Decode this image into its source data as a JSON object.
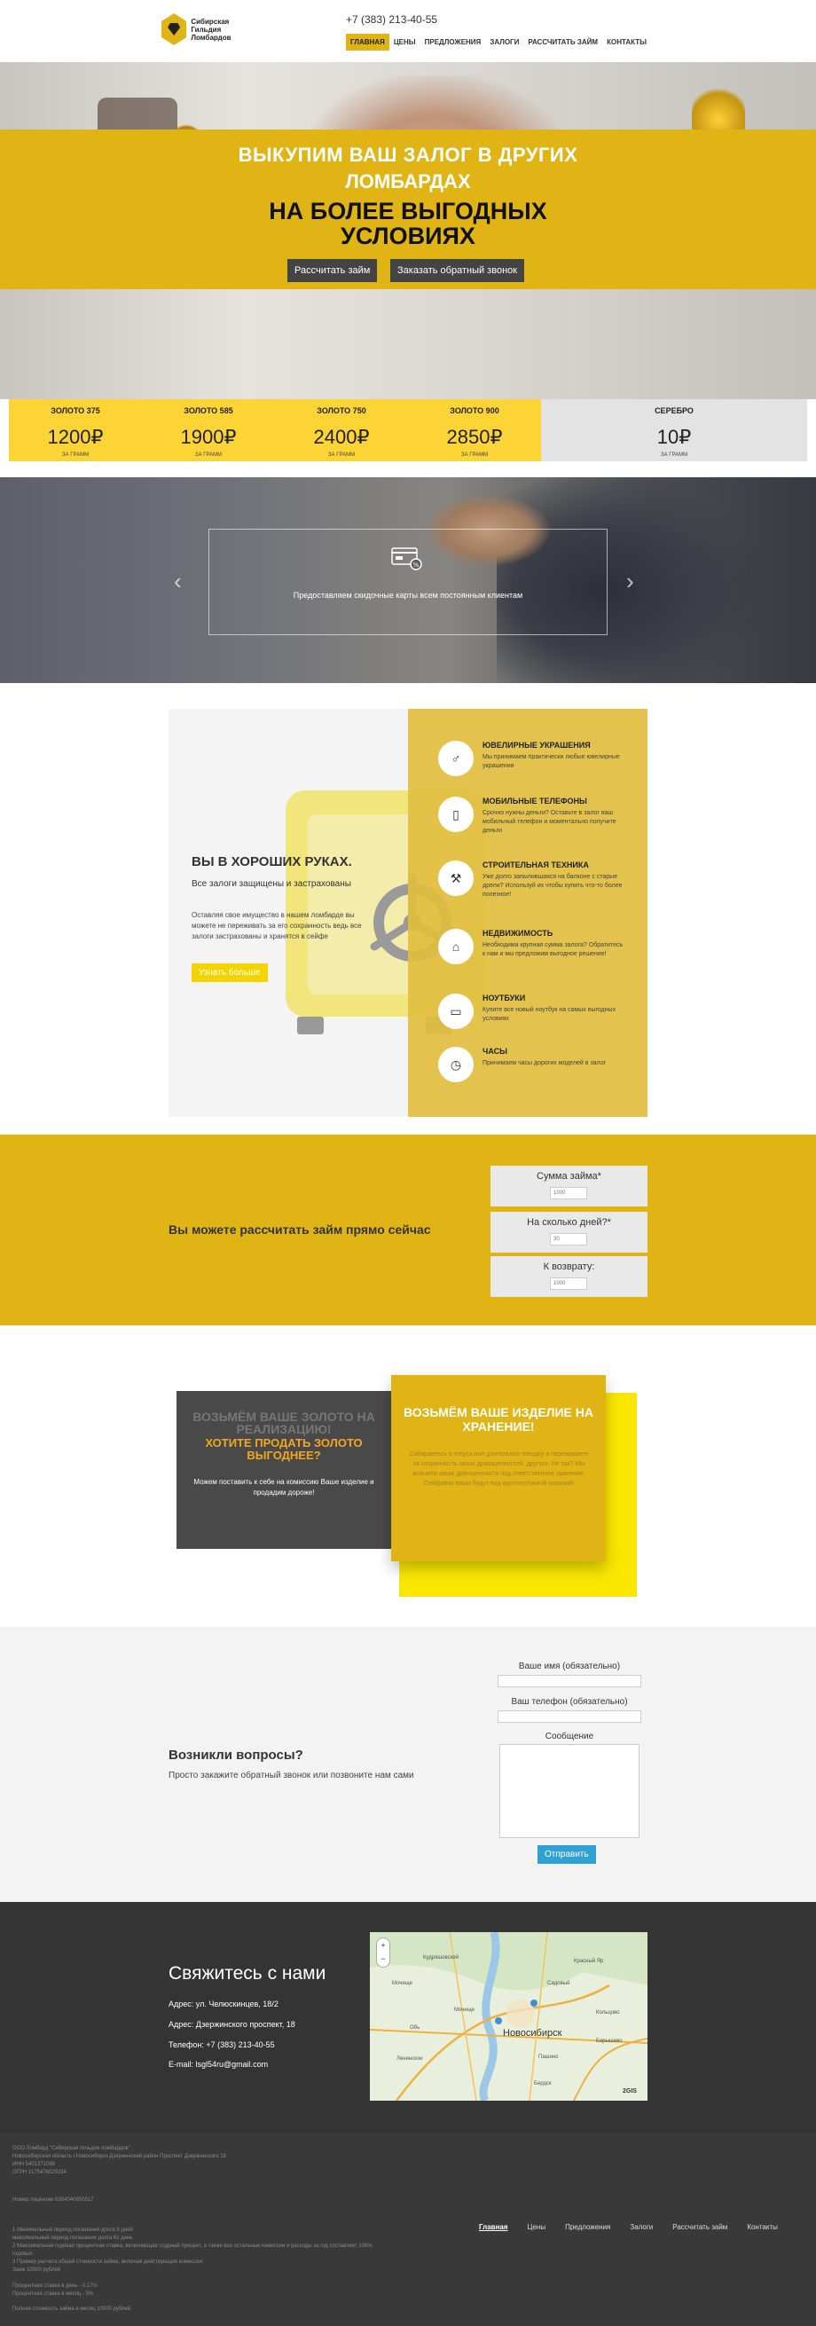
{
  "header": {
    "logo_text": "Сибирская Гильдия Ломбардов",
    "phone": "+7 (383) 213-40-55",
    "nav": [
      "Главная",
      "Цены",
      "Предложения",
      "Залоги",
      "Рассчитать займ",
      "Контакты"
    ],
    "active_nav": "Главная"
  },
  "hero": {
    "line1": "Выкупим ваш  залог в других",
    "line2": "ломбардах",
    "line3": "на более выгодных",
    "line4": "условиях",
    "btn_calc": "Рассчитать займ",
    "btn_call": "Заказать обратный звонок"
  },
  "prices": [
    {
      "title": "ЗОЛОТО 375",
      "value": "1200₽",
      "unit": "ЗА ГРАММ"
    },
    {
      "title": "ЗОЛОТО 585",
      "value": "1900₽",
      "unit": "ЗА ГРАММ"
    },
    {
      "title": "ЗОЛОТО 750",
      "value": "2400₽",
      "unit": "ЗА ГРАММ"
    },
    {
      "title": "ЗОЛОТО 900",
      "value": "2850₽",
      "unit": "ЗА ГРАММ"
    },
    {
      "title": "СЕРЕБРО",
      "value": "10₽",
      "unit": "ЗА ГРАММ"
    }
  ],
  "slider": {
    "text": "Предоставляем скидочные карты всем постоянным клиентам",
    "prev": "‹",
    "next": "›"
  },
  "safe": {
    "title": "Вы в хороших руках.",
    "subtitle": "Все залоги защищены и застрахованы",
    "desc": "Оставляя свое имущество в нашем ломбарде вы можете не переживать за его сохранность ведь все залоги застрахованы и хранятся в сейфе",
    "btn": "Узнать больше",
    "features": [
      {
        "icon": "♂",
        "title": "Ювелирные украшения",
        "desc": "Мы принимаем практически любые ювелирные украшения"
      },
      {
        "icon": "▯",
        "title": "Мобильные телефоны",
        "desc": "Срочно нужны деньги? Оставьте в залог ваш мобильный телефон и моментально получите деньги"
      },
      {
        "icon": "⚒",
        "title": "Строительная техника",
        "desc": "Уже долго запылившаяся на балконе с старые дрели? Используй их чтобы купить что-то более полезное!"
      },
      {
        "icon": "⌂",
        "title": "Недвижимость",
        "desc": "Необходима крупная сумма залога? Обратитесь к нам и мы предложим выгодное решение!"
      },
      {
        "icon": "▭",
        "title": "Ноутбуки",
        "desc": "Купите все новый ноутбук на самых выгодных условиях"
      },
      {
        "icon": "◷",
        "title": "Часы",
        "desc": "Принимаем часы дорогих моделей в залог"
      }
    ]
  },
  "calc": {
    "title": "Вы можете рассчитать займ прямо сейчас",
    "fields": [
      {
        "label": "Сумма займа*",
        "value": "1000"
      },
      {
        "label": "На сколько дней?*",
        "value": "30"
      },
      {
        "label": "К возврату:",
        "value": "1000"
      }
    ]
  },
  "offers": {
    "sell_title": "Возьмём ваше золото на реализацию!",
    "sell_question": "Хотите продать золото выгоднее?",
    "sell_desc": "Можем поставить к себе на комиссию Ваше изделие и продадим дороже!",
    "store_title": "Возьмём ваше изделие на хранение!",
    "store_desc": "Собираетесь в отпуск или длительное поездку и переживаете за сохранность своих драгоценностей, другого. Не так? Мы возьмём ваши драгоценности под ответственное хранение. Сейфовое ваши будут под круглосуточной охраной!"
  },
  "contact_form": {
    "title": "Возникли вопросы?",
    "subtitle": "Просто закажите обратный звонок или позвоните нам сами",
    "name_label": "Ваше имя (обязательно)",
    "phone_label": "Ваш телефон (обязательно)",
    "message_label": "Сообщение",
    "send": "Отправить"
  },
  "contacts": {
    "title": "Свяжитесь с нами",
    "address1": "Адрес: ул. Челюскинцев, 18/2",
    "address2": "Адрес: Дзержинского проспект, 18",
    "phone": "Телефон: +7 (383) 213-40-55",
    "email": "E-mail: lsgl54ru@gmail.com",
    "map_city": "Новосибирск",
    "map_brand": "2GIS",
    "map_labels": [
      "Кудряшовский",
      "Красный Яр",
      "Мочище",
      "Садовый",
      "Кольцово",
      "Барышево",
      "Пашино",
      "Ленинское",
      "Бердск",
      "Обь",
      "Мочище"
    ]
  },
  "footer": {
    "company": "ООО Ломбард \"Сибирская гильдия ломбардов\"",
    "address": "Новосибирская область г.Новосибирск Дзержинский район Проспект Дзержинского 18",
    "inn": "ИНН 5401371086",
    "ogrn": "ОГРН 1175476029234",
    "license": "Номер лицензии 6304040650517",
    "terms": [
      "1 Минимальный период погашения долга 5 дней",
      "максимальный период погашения долга 61 день",
      "2 Максимальная годовая процентная ставка, включающая ссудный процент, а также все остальные комиссии и расходы за год составляет 106% годовых",
      "3 Пример расчета общей стоимости займа, включая действующие комиссии:",
      "Заем 10000 рублей",
      "Процентная ставка в день - 0,17%",
      "Процентная ставка в месяц - 5%",
      "Полная стоимость займа в месяц 10500 рублей"
    ],
    "nav": [
      "Главная",
      "Цены",
      "Предложения",
      "Залоги",
      "Рассчитать займ",
      "Контакты"
    ]
  },
  "colors": {
    "accent": "#e0b415",
    "dark": "#343434",
    "button_blue": "#31a0d4"
  }
}
